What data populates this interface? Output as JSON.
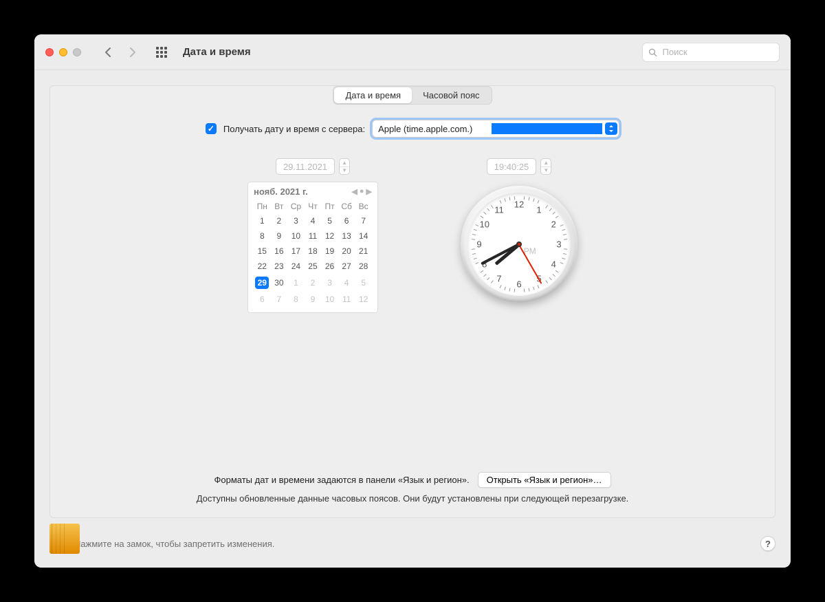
{
  "window": {
    "title": "Дата и время"
  },
  "search": {
    "placeholder": "Поиск"
  },
  "tabs": {
    "date_time": "Дата и время",
    "timezone": "Часовой пояс"
  },
  "auto": {
    "label": "Получать дату и время с сервера:",
    "server": "Apple (time.apple.com.)"
  },
  "date": {
    "value": "29.11.2021",
    "month_label": "нояб. 2021 г.",
    "weekdays": [
      "Пн",
      "Вт",
      "Ср",
      "Чт",
      "Пт",
      "Сб",
      "Вс"
    ],
    "grid": [
      [
        {
          "d": 1
        },
        {
          "d": 2
        },
        {
          "d": 3
        },
        {
          "d": 4
        },
        {
          "d": 5
        },
        {
          "d": 6
        },
        {
          "d": 7
        }
      ],
      [
        {
          "d": 8
        },
        {
          "d": 9
        },
        {
          "d": 10
        },
        {
          "d": 11
        },
        {
          "d": 12
        },
        {
          "d": 13
        },
        {
          "d": 14
        }
      ],
      [
        {
          "d": 15
        },
        {
          "d": 16
        },
        {
          "d": 17
        },
        {
          "d": 18
        },
        {
          "d": 19
        },
        {
          "d": 20
        },
        {
          "d": 21
        }
      ],
      [
        {
          "d": 22
        },
        {
          "d": 23
        },
        {
          "d": 24
        },
        {
          "d": 25
        },
        {
          "d": 26
        },
        {
          "d": 27
        },
        {
          "d": 28
        }
      ],
      [
        {
          "d": 29,
          "sel": true
        },
        {
          "d": 30
        },
        {
          "d": 1,
          "off": true
        },
        {
          "d": 2,
          "off": true
        },
        {
          "d": 3,
          "off": true
        },
        {
          "d": 4,
          "off": true
        },
        {
          "d": 5,
          "off": true
        }
      ],
      [
        {
          "d": 6,
          "off": true
        },
        {
          "d": 7,
          "off": true
        },
        {
          "d": 8,
          "off": true
        },
        {
          "d": 9,
          "off": true
        },
        {
          "d": 10,
          "off": true
        },
        {
          "d": 11,
          "off": true
        },
        {
          "d": 12,
          "off": true
        }
      ]
    ]
  },
  "time": {
    "value": "19:40:25",
    "ampm": "PM",
    "h": 19,
    "m": 40,
    "s": 25
  },
  "footer": {
    "formats_msg": "Форматы дат и времени задаются в панели «Язык и регион».",
    "open_btn": "Открыть «Язык и регион»…",
    "tz_update_msg": "Доступны обновленные данные часовых поясов. Они будут установлены при следующей перезагрузке."
  },
  "lock": {
    "text": "Нажмите на замок, чтобы запретить изменения."
  }
}
